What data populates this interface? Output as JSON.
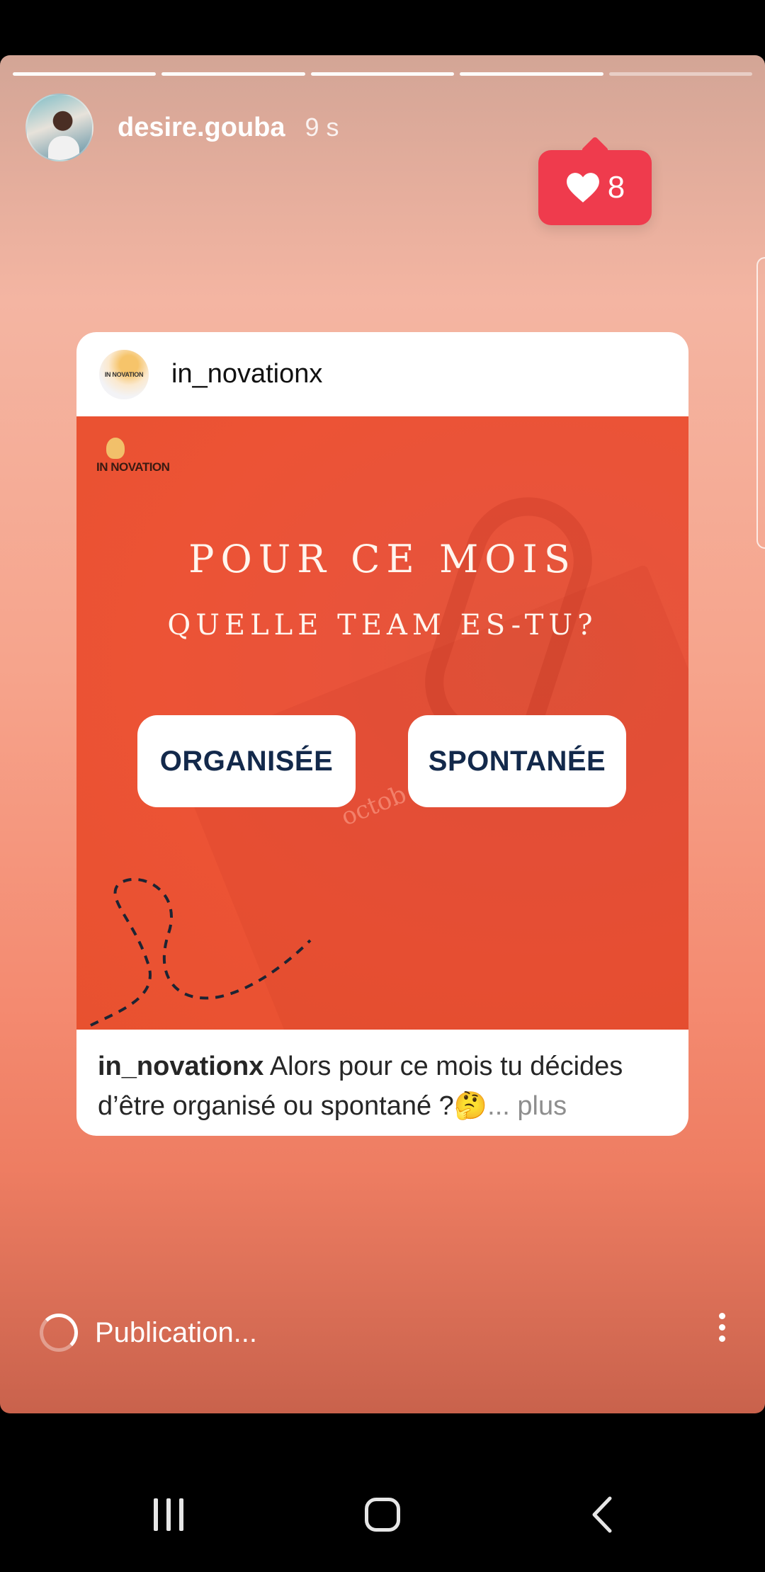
{
  "story": {
    "username": "desire.gouba",
    "time": "9 s",
    "progress_segments": 5,
    "progress_completed": 4,
    "likes": "8",
    "avatar_icon": "profile-photo"
  },
  "post": {
    "username": "in_novationx",
    "avatar_text": "IN NOVATION",
    "brand_text": "IN NOVATION",
    "headline_line1": "POUR CE MOIS",
    "headline_line2": "QUELLE TEAM ES-TU?",
    "option_left": "ORGANISÉE",
    "option_right": "SPONTANÉE",
    "background_word": "octob",
    "caption_user": "in_novationx",
    "caption_text": " Alors pour ce mois tu décides d’être organisé ou spontané ?🤔",
    "caption_more": "... plus"
  },
  "footer": {
    "status": "Publication...",
    "menu_icon": "more-vertical-icon"
  },
  "nav": {
    "recents_icon": "recents-icon",
    "home_icon": "home-icon",
    "back_icon": "back-icon"
  },
  "colors": {
    "like_badge": "#ef3b4d",
    "post_image_bg": "#e9533a",
    "option_text": "#13294b"
  }
}
